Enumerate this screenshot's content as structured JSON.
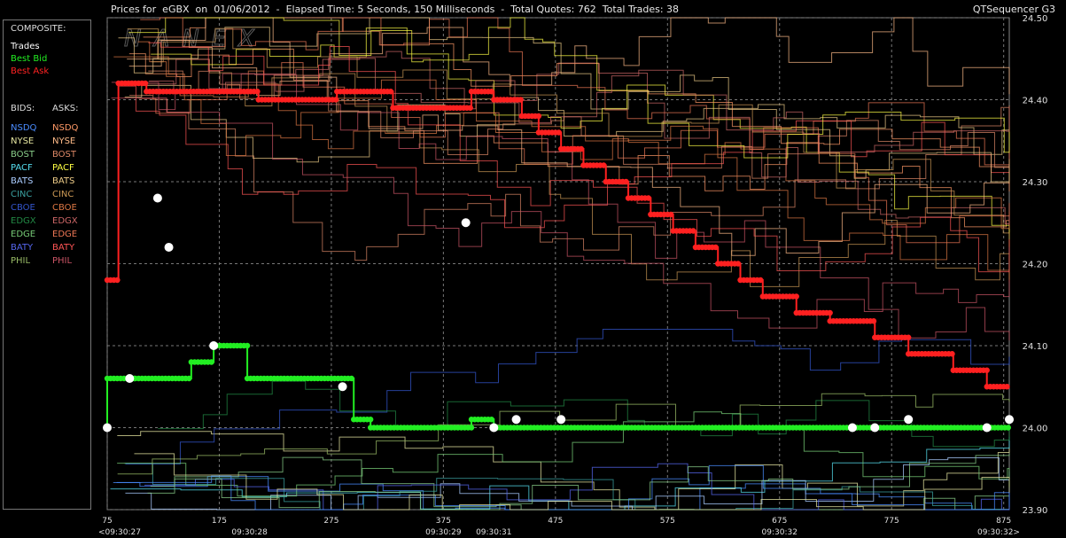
{
  "header": {
    "title": "Prices for  eGBX  on  01/06/2012  -  Elapsed Time: 5 Seconds, 150 Milliseconds  -  Total Quotes: 762  Total Trades: 38",
    "app": "QTSequencer G3"
  },
  "watermark": "NANEX",
  "legend": {
    "composite_title": "COMPOSITE:",
    "composite": [
      {
        "label": "Trades",
        "color": "#ffffff"
      },
      {
        "label": "Best Bid",
        "color": "#22ee22"
      },
      {
        "label": "Best Ask",
        "color": "#ff2222"
      }
    ],
    "bids_title": "BIDS:",
    "asks_title": "ASKS:",
    "bids": [
      {
        "label": "NSDQ",
        "color": "#4a8cff"
      },
      {
        "label": "NYSE",
        "color": "#e6e6a0"
      },
      {
        "label": "BOST",
        "color": "#88cc88"
      },
      {
        "label": "PACF",
        "color": "#55ddee"
      },
      {
        "label": "BATS",
        "color": "#aaccff"
      },
      {
        "label": "CINC",
        "color": "#3aa0a0"
      },
      {
        "label": "CBOE",
        "color": "#3355cc"
      },
      {
        "label": "EDGX",
        "color": "#228844"
      },
      {
        "label": "EDGE",
        "color": "#77cc77"
      },
      {
        "label": "BATY",
        "color": "#5566ee"
      },
      {
        "label": "PHIL",
        "color": "#99bb66"
      }
    ],
    "asks": [
      {
        "label": "NSDQ",
        "color": "#ff9966"
      },
      {
        "label": "NYSE",
        "color": "#ffbb88"
      },
      {
        "label": "BOST",
        "color": "#dd8866"
      },
      {
        "label": "PACF",
        "color": "#ffff44"
      },
      {
        "label": "BATS",
        "color": "#eecc88"
      },
      {
        "label": "CINC",
        "color": "#cc9955"
      },
      {
        "label": "CBOE",
        "color": "#dd7744"
      },
      {
        "label": "EDGX",
        "color": "#cc6666"
      },
      {
        "label": "EDGE",
        "color": "#ee7755"
      },
      {
        "label": "BATY",
        "color": "#ff5555"
      },
      {
        "label": "PHIL",
        "color": "#cc5566"
      }
    ]
  },
  "chart_data": {
    "type": "line",
    "ylim": [
      23.9,
      24.5
    ],
    "xlim": [
      75,
      880
    ],
    "y_ticks": [
      "24.50",
      "24.40",
      "24.30",
      "24.20",
      "24.10",
      "24.00",
      "23.90"
    ],
    "x_ticks": [
      "75",
      "175",
      "275",
      "375",
      "475",
      "575",
      "675",
      "775",
      "875"
    ],
    "time_labels": [
      {
        "x": 75,
        "label": "<09:30:27"
      },
      {
        "x": 202,
        "label": "09:30:28"
      },
      {
        "x": 375,
        "label": "09:30:29"
      },
      {
        "x": 420,
        "label": "09:30:31"
      },
      {
        "x": 675,
        "label": "09:30:32"
      },
      {
        "x": 880,
        "label": "09:30:32>"
      }
    ],
    "grid": true,
    "series": [
      {
        "name": "Best Ask",
        "color": "#ff2020",
        "points": [
          [
            75,
            24.18
          ],
          [
            85,
            24.18
          ],
          [
            85,
            24.42
          ],
          [
            110,
            24.42
          ],
          [
            110,
            24.41
          ],
          [
            210,
            24.41
          ],
          [
            210,
            24.4
          ],
          [
            280,
            24.4
          ],
          [
            280,
            24.41
          ],
          [
            330,
            24.41
          ],
          [
            330,
            24.39
          ],
          [
            400,
            24.39
          ],
          [
            400,
            24.41
          ],
          [
            420,
            24.41
          ],
          [
            420,
            24.4
          ],
          [
            445,
            24.4
          ],
          [
            445,
            24.38
          ],
          [
            460,
            24.38
          ],
          [
            460,
            24.36
          ],
          [
            480,
            24.36
          ],
          [
            480,
            24.34
          ],
          [
            500,
            24.34
          ],
          [
            500,
            24.32
          ],
          [
            520,
            24.32
          ],
          [
            520,
            24.3
          ],
          [
            540,
            24.3
          ],
          [
            540,
            24.28
          ],
          [
            560,
            24.28
          ],
          [
            560,
            24.26
          ],
          [
            580,
            24.26
          ],
          [
            580,
            24.24
          ],
          [
            600,
            24.24
          ],
          [
            600,
            24.22
          ],
          [
            620,
            24.22
          ],
          [
            620,
            24.2
          ],
          [
            640,
            24.2
          ],
          [
            640,
            24.18
          ],
          [
            660,
            24.18
          ],
          [
            660,
            24.16
          ],
          [
            690,
            24.16
          ],
          [
            690,
            24.14
          ],
          [
            720,
            24.14
          ],
          [
            720,
            24.13
          ],
          [
            760,
            24.13
          ],
          [
            760,
            24.11
          ],
          [
            790,
            24.11
          ],
          [
            790,
            24.09
          ],
          [
            830,
            24.09
          ],
          [
            830,
            24.07
          ],
          [
            860,
            24.07
          ],
          [
            860,
            24.05
          ],
          [
            880,
            24.05
          ]
        ]
      },
      {
        "name": "Best Bid",
        "color": "#22ee22",
        "points": [
          [
            75,
            24.0
          ],
          [
            75,
            24.06
          ],
          [
            100,
            24.06
          ],
          [
            150,
            24.06
          ],
          [
            150,
            24.08
          ],
          [
            170,
            24.08
          ],
          [
            170,
            24.1
          ],
          [
            200,
            24.1
          ],
          [
            200,
            24.06
          ],
          [
            295,
            24.06
          ],
          [
            295,
            24.01
          ],
          [
            310,
            24.01
          ],
          [
            310,
            24.0
          ],
          [
            400,
            24.0
          ],
          [
            400,
            24.01
          ],
          [
            420,
            24.01
          ],
          [
            420,
            24.0
          ],
          [
            880,
            24.0
          ]
        ]
      },
      {
        "name": "Trades",
        "color": "#ffffff",
        "points": [
          [
            75,
            24.0
          ],
          [
            95,
            24.06
          ],
          [
            120,
            24.28
          ],
          [
            130,
            24.22
          ],
          [
            170,
            24.1
          ],
          [
            285,
            24.05
          ],
          [
            395,
            24.25
          ],
          [
            420,
            24.0
          ],
          [
            440,
            24.01
          ],
          [
            480,
            24.01
          ],
          [
            740,
            24.0
          ],
          [
            760,
            24.0
          ],
          [
            790,
            24.01
          ],
          [
            860,
            24.0
          ],
          [
            880,
            24.01
          ]
        ]
      }
    ]
  }
}
